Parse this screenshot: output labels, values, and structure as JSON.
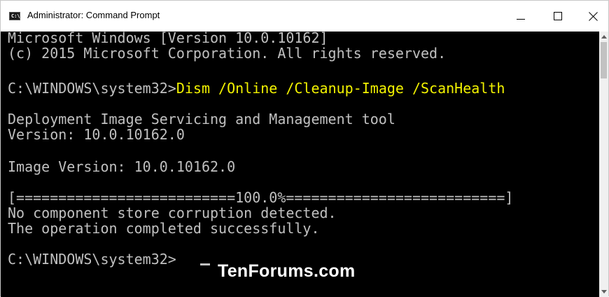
{
  "window": {
    "title": "Administrator: Command Prompt",
    "icon_text": "C:\\"
  },
  "console": {
    "banner_line1": "Microsoft Windows [Version 10.0.10162]",
    "banner_line2": "(c) 2015 Microsoft Corporation. All rights reserved.",
    "prompt": "C:\\WINDOWS\\system32>",
    "command": "Dism /Online /Cleanup-Image /ScanHealth",
    "tool_name": "Deployment Image Servicing and Management tool",
    "tool_version": "Version: 10.0.10162.0",
    "image_version": "Image Version: 10.0.10162.0",
    "progress_bar": "[==========================100.0%==========================]",
    "result_line1": "No component store corruption detected.",
    "result_line2": "The operation completed successfully.",
    "final_prompt": "C:\\WINDOWS\\system32>"
  },
  "watermark": "TenForums.com",
  "colors": {
    "console_bg": "#000000",
    "console_text": "#c0c0c0",
    "command_text": "#f2f200",
    "titlebar_bg": "#ffffff"
  },
  "icons": [
    "cmd-app-icon",
    "minimize-icon",
    "maximize-icon",
    "close-icon",
    "scroll-up-arrow-icon",
    "scroll-down-arrow-icon"
  ]
}
